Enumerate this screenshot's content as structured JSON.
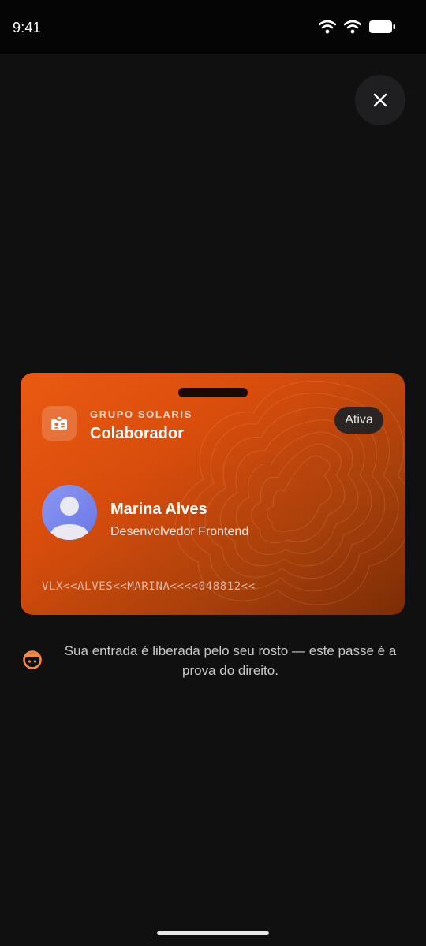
{
  "status_bar": {
    "time": "9:41",
    "icons": [
      "wifi-icon",
      "wifi-icon",
      "battery-icon"
    ]
  },
  "close_button": {
    "icon": "close-icon"
  },
  "card": {
    "organization": "GRUPO SOLARIS",
    "type": "Colaborador",
    "status": "Ativa",
    "logo_icon": "id-badge-icon",
    "name": "Marina Alves",
    "role": "Desenvolvedor Frontend",
    "mrz": "VLX<<ALVES<<MARINA<<<<048812<<",
    "colors": {
      "gradient_start": "#ea5a12",
      "gradient_end": "#7c2c06",
      "avatar": "#7b87ee"
    }
  },
  "info": {
    "icon": "face-icon",
    "text": "Sua entrada é liberada pelo seu rosto — este passe é a prova do direito."
  },
  "accent_color": "#f08a4b"
}
